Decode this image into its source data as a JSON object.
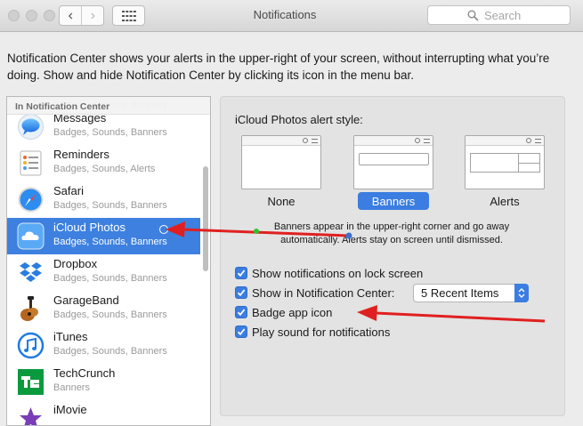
{
  "window": {
    "title": "Notifications"
  },
  "nav": {
    "back": "‹",
    "forward": "›"
  },
  "search": {
    "placeholder": "Search"
  },
  "description": "Notification Center shows your alerts in the upper-right of your screen, without interrupting what you’re doing. Show and hide Notification Center by clicking its icon in the menu bar.",
  "sidebar": {
    "section_header": "In Notification Center",
    "items": [
      {
        "name": "Messages",
        "sub": "Badges, Sounds, Banners",
        "icon": "messages-icon"
      },
      {
        "name": "Reminders",
        "sub": "Badges, Sounds, Alerts",
        "icon": "reminders-icon"
      },
      {
        "name": "Safari",
        "sub": "Badges, Sounds, Banners",
        "icon": "safari-icon"
      },
      {
        "name": "iCloud Photos",
        "sub": "Badges, Sounds, Banners",
        "icon": "icloud-icon",
        "selected": true
      },
      {
        "name": "Dropbox",
        "sub": "Badges, Sounds, Banners",
        "icon": "dropbox-icon"
      },
      {
        "name": "GarageBand",
        "sub": "Badges, Sounds, Banners",
        "icon": "garageband-icon"
      },
      {
        "name": "iTunes",
        "sub": "Badges, Sounds, Banners",
        "icon": "itunes-icon"
      },
      {
        "name": "TechCrunch",
        "sub": "Banners",
        "icon": "techcrunch-icon"
      },
      {
        "name": "iMovie",
        "sub": "",
        "icon": "imovie-icon"
      }
    ]
  },
  "panel": {
    "alert_style_title": "iCloud Photos alert style:",
    "styles": [
      {
        "label": "None",
        "selected": false
      },
      {
        "label": "Banners",
        "selected": true
      },
      {
        "label": "Alerts",
        "selected": false
      }
    ],
    "explanation": "Banners appear in the upper-right corner and go away automatically. Alerts stay on screen until dismissed.",
    "options": [
      {
        "label": "Show notifications on lock screen",
        "checked": true
      },
      {
        "label": "Show in Notification Center:",
        "checked": true
      },
      {
        "label": "Badge app icon",
        "checked": true
      },
      {
        "label": "Play sound for notifications",
        "checked": true
      }
    ],
    "recent_items": "5 Recent Items"
  },
  "colors": {
    "accent": "#3b7de0",
    "selection": "#3d80df",
    "annotation_arrow": "#e02020"
  }
}
